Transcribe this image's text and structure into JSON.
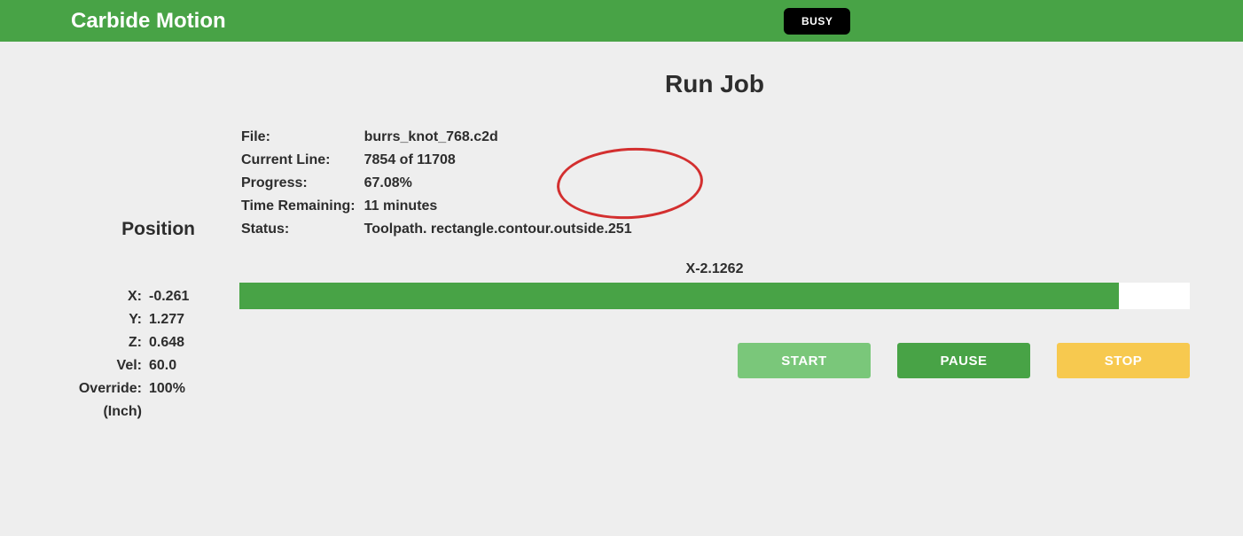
{
  "header": {
    "app_title": "Carbide Motion",
    "status_badge": "BUSY"
  },
  "sidebar": {
    "title": "Position",
    "rows": {
      "x_label": "X:",
      "x_value": "-0.261",
      "y_label": "Y:",
      "y_value": "1.277",
      "z_label": "Z:",
      "z_value": "0.648",
      "vel_label": "Vel:",
      "vel_value": "60.0",
      "override_label": "Override:",
      "override_value": "100%",
      "unit": "(Inch)"
    }
  },
  "main": {
    "page_title": "Run Job",
    "info": {
      "file_label": "File:",
      "file_value": "burrs_knot_768.c2d",
      "current_line_label": "Current Line:",
      "current_line_value": "7854 of 11708",
      "progress_label": "Progress:",
      "progress_value": "67.08%",
      "time_remaining_label": "Time Remaining:",
      "time_remaining_value": "11 minutes",
      "status_label": "Status:",
      "status_value": "Toolpath. rectangle.contour.outside.251"
    },
    "axis_readout": "X-2.1262",
    "progress_percent": 92.5,
    "buttons": {
      "start": "START",
      "pause": "PAUSE",
      "stop": "STOP"
    }
  }
}
